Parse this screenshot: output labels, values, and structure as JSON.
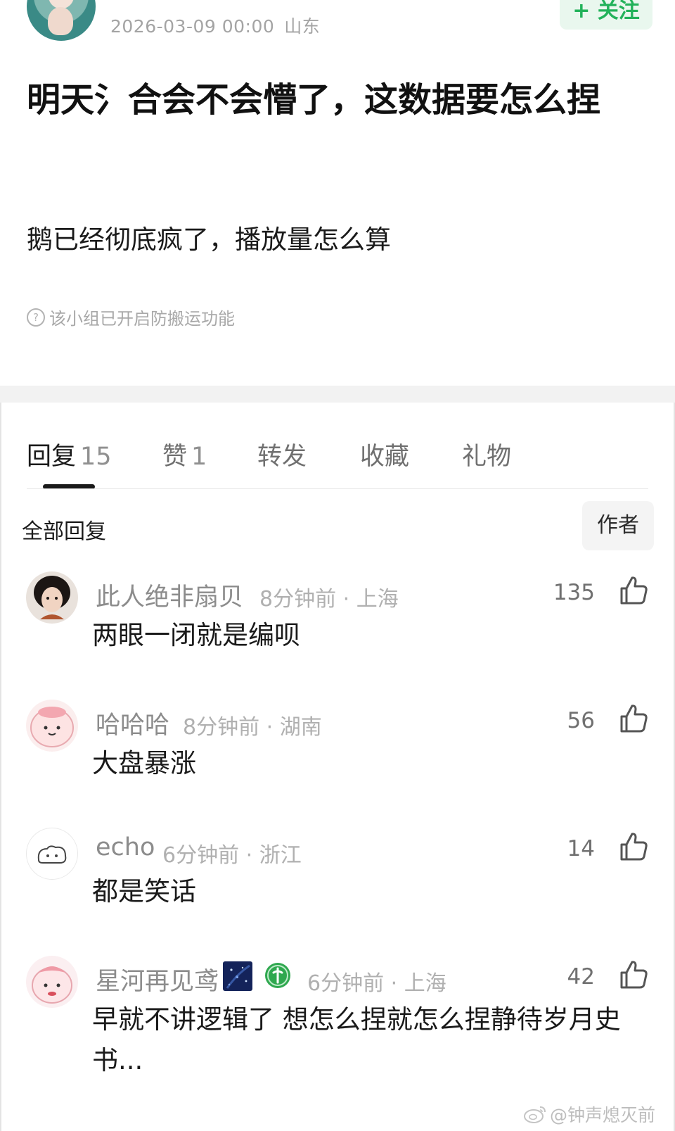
{
  "post": {
    "timestamp": "2026-03-09 00:00",
    "location": "山东",
    "follow_label": "+ 关注",
    "title": "明天氵合会不会懵了，这数据要怎么捏",
    "body": "鹅已经彻底疯了，播放量怎么算",
    "anti_repost_note": "该小组已开启防搬运功能"
  },
  "tabs": [
    {
      "label": "回复",
      "count": "15",
      "active": true
    },
    {
      "label": "赞",
      "count": "1",
      "active": false
    },
    {
      "label": "转发",
      "count": "",
      "active": false
    },
    {
      "label": "收藏",
      "count": "",
      "active": false
    },
    {
      "label": "礼物",
      "count": "",
      "active": false
    }
  ],
  "filter": {
    "label": "全部回复",
    "author_chip": "作者"
  },
  "comments": [
    {
      "name": "此人绝非扇贝",
      "time": "8分钟前 · 上海",
      "text": "两眼一闭就是编呗",
      "likes": "135"
    },
    {
      "name": "哈哈哈",
      "time": "8分钟前 · 湖南",
      "text": "大盘暴涨",
      "likes": "56"
    },
    {
      "name": "echo",
      "time": "6分钟前 · 浙江",
      "text": "都是笑话",
      "likes": "14"
    },
    {
      "name": "星河再见鸢",
      "time": "6分钟前 · 上海",
      "text": "早就不讲逻辑了 想怎么捏就怎么捏静待岁月史书...",
      "likes": "42"
    }
  ],
  "watermark": "@钟声熄灭前",
  "icons": {
    "like": "thumbs-up-icon",
    "help": "question-circle-icon",
    "weibo": "weibo-logo-icon"
  },
  "colors": {
    "accent_green": "#22b25a",
    "follow_bg": "#e9f7ee",
    "muted_text": "#a4a4a4"
  }
}
